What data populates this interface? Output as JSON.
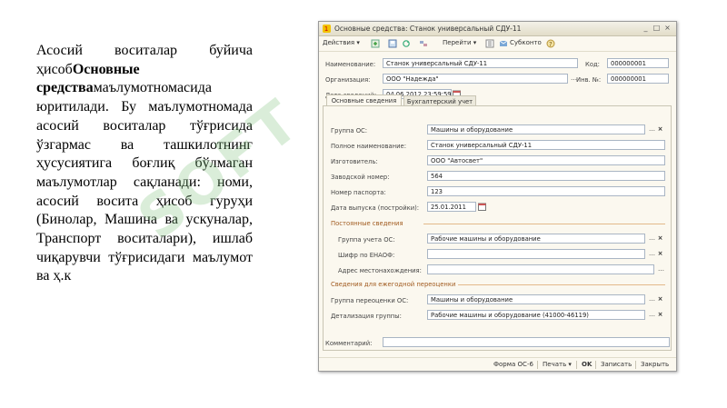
{
  "slide": {
    "text_part1": "Асосий воситалар буйича ҳисоб",
    "text_bold": "Основные средства",
    "text_part2": "маълумотномасида юритилади. Бу маълумотномада асосий воситалар тўғрисида ўзгармас ва ташкилотнинг ҳусусиятига боғлиқ бўлмаган маълумотлар сақланади: номи, асосий восита ҳисоб гуруҳи (Бинолар, Машина ва ускуналар, Транспорт воситалари), ишлаб чиқарувчи тўғрисидаги маълумот ва ҳ.к",
    "watermark": "SOFT"
  },
  "window": {
    "title": "Основные средства: Станок универсальный СДУ-11",
    "controls": {
      "minimize": "_",
      "restore": "□",
      "close": "×"
    }
  },
  "toolbar": {
    "actions": "Действия ▾",
    "goto": "Перейти ▾",
    "subconto": "Субконто"
  },
  "header": {
    "name_label": "Наименование:",
    "name_value": "Станок универсальный СДУ-11",
    "code_label": "Код:",
    "code_value": "000000001",
    "org_label": "Организация:",
    "org_value": "ООО \"Надежда\"",
    "inv_label": "Инв. №:",
    "inv_value": "000000001",
    "date_label": "Дата сведений:",
    "date_value": "04.06.2012 23:59:59"
  },
  "tabs": [
    {
      "label": "Основные сведения"
    },
    {
      "label": "Бухгалтерский учет"
    }
  ],
  "main": {
    "group_os_label": "Группа ОС:",
    "group_os_value": "Машины и оборудование",
    "full_name_label": "Полное наименование:",
    "full_name_value": "Станок универсальный СДУ-11",
    "maker_label": "Изготовитель:",
    "maker_value": "ООО \"Автосвет\"",
    "serial_label": "Заводской номер:",
    "serial_value": "564",
    "passport_label": "Номер паспорта:",
    "passport_value": "123",
    "release_label": "Дата выпуска (постройки):",
    "release_value": "25.01.2011"
  },
  "permanent": {
    "title": "Постоянные сведения",
    "group_label": "Группа учета ОС:",
    "group_value": "Рабочие машины и оборудование",
    "enaof_label": "Шифр по ЕНАОФ:",
    "enaof_value": "",
    "address_label": "Адрес местонахождения:",
    "address_value": ""
  },
  "revaluation": {
    "title": "Сведения для ежегодной переоценки",
    "group_label": "Группа переоценки ОС:",
    "group_value": "Машины и оборудование",
    "detail_label": "Детализация группы:",
    "detail_value": "Рабочие машины и оборудование (41000-46119)"
  },
  "comment": {
    "label": "Комментарий:",
    "value": ""
  },
  "footer": {
    "form": "Форма ОС-6",
    "print": "Печать ▾",
    "ok": "OK",
    "save": "Записать",
    "close": "Закрыть"
  }
}
